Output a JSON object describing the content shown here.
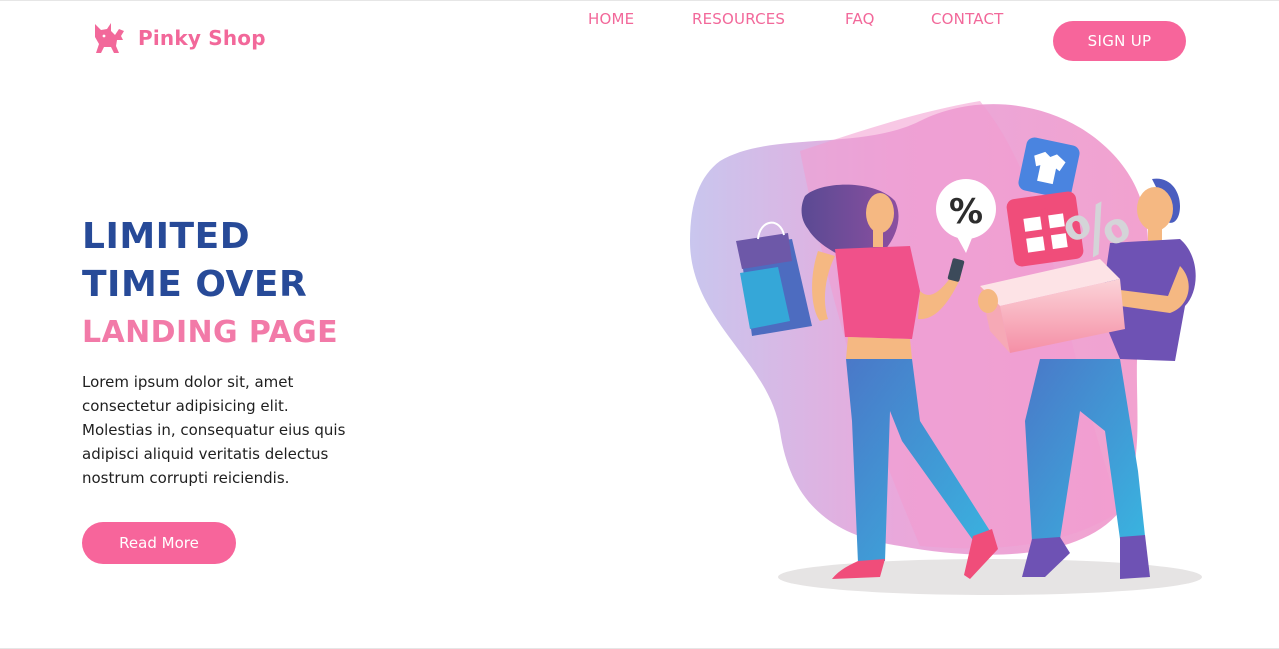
{
  "brand": {
    "name": "Pinky Shop",
    "icon": "cat-icon",
    "color": "#f2689a"
  },
  "nav": {
    "items": [
      {
        "label": "HOME"
      },
      {
        "label": "RESOURCES"
      },
      {
        "label": "FAQ"
      },
      {
        "label": "CONTACT"
      }
    ],
    "signup_label": "SIGN UP"
  },
  "hero": {
    "title_line1": "LIMITED",
    "title_line2": "TIME OVER",
    "subtitle": "LANDING PAGE",
    "text_lines": [
      "Lorem ipsum dolor sit, amet",
      "consectetur adipisicing elit.",
      "Molestias in, consequatur eius quis",
      "adipisci aliquid veritatis delectus",
      "nostrum corrupti reiciendis."
    ],
    "cta_label": "Read More"
  },
  "illustration": {
    "speech_bubble_text": "%",
    "tag_text": "%"
  },
  "colors": {
    "accent": "#f7659b",
    "title": "#274a98",
    "subtitle": "#f27aa8",
    "blob_pink": "#f29ad0",
    "blob_lavender": "#c9c6ee"
  }
}
